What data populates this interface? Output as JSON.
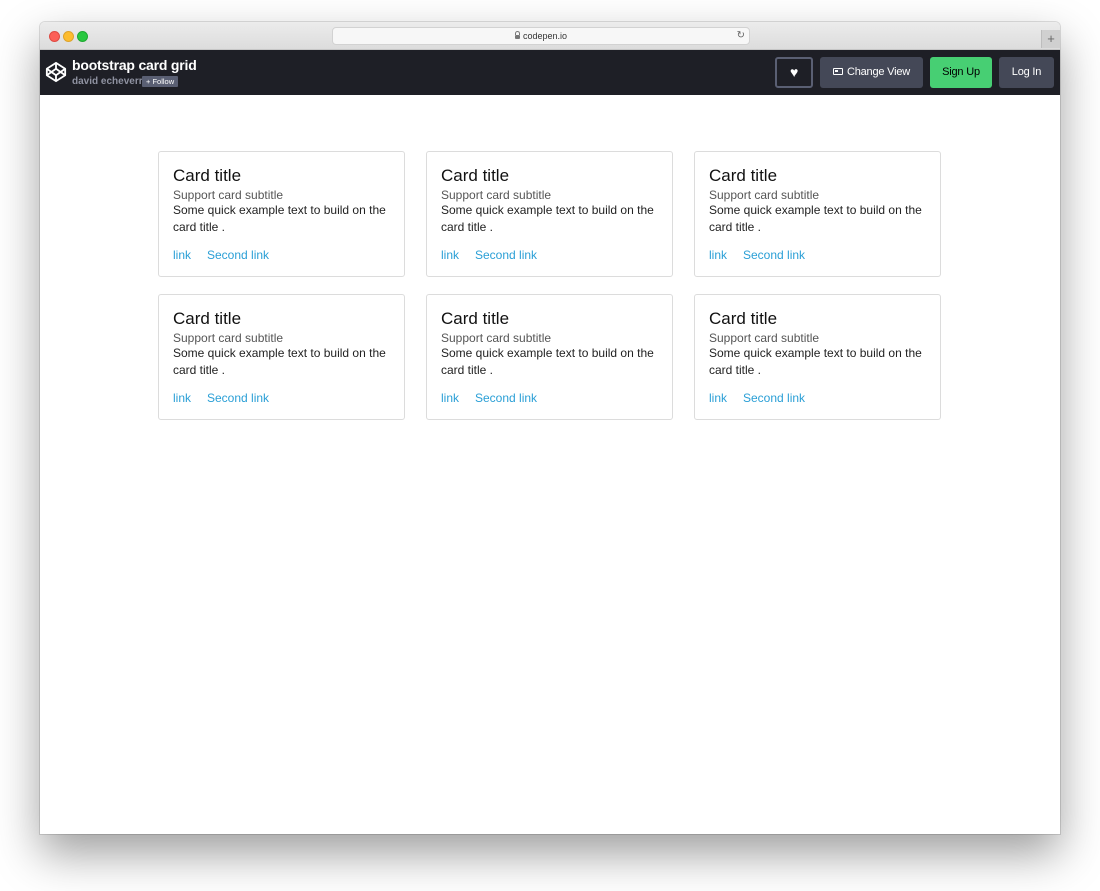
{
  "browser": {
    "url": "codepen.io",
    "new_tab": "+",
    "reload": "↻"
  },
  "header": {
    "title": "bootstrap card grid",
    "author": "david echeverri",
    "follow_label": "+ Follow",
    "heart": "♥",
    "change_view_label": "Change View",
    "signup_label": "Sign Up",
    "login_label": "Log In"
  },
  "colors": {
    "header_bg": "#1e1f26",
    "signup_green": "#47cf73",
    "button_gray": "#444857",
    "link_blue": "#2a9fd6"
  },
  "cards": [
    {
      "title": "Card title",
      "subtitle": "Support card subtitle",
      "text": "Some quick example text to build on the card title .",
      "link1": "link",
      "link2": "Second link"
    },
    {
      "title": "Card title",
      "subtitle": "Support card subtitle",
      "text": "Some quick example text to build on the card title .",
      "link1": "link",
      "link2": "Second link"
    },
    {
      "title": "Card title",
      "subtitle": "Support card subtitle",
      "text": "Some quick example text to build on the card title .",
      "link1": "link",
      "link2": "Second link"
    },
    {
      "title": "Card title",
      "subtitle": "Support card subtitle",
      "text": "Some quick example text to build on the card title .",
      "link1": "link",
      "link2": "Second link"
    },
    {
      "title": "Card title",
      "subtitle": "Support card subtitle",
      "text": "Some quick example text to build on the card title .",
      "link1": "link",
      "link2": "Second link"
    },
    {
      "title": "Card title",
      "subtitle": "Support card subtitle",
      "text": "Some quick example text to build on the card title .",
      "link1": "link",
      "link2": "Second link"
    }
  ]
}
